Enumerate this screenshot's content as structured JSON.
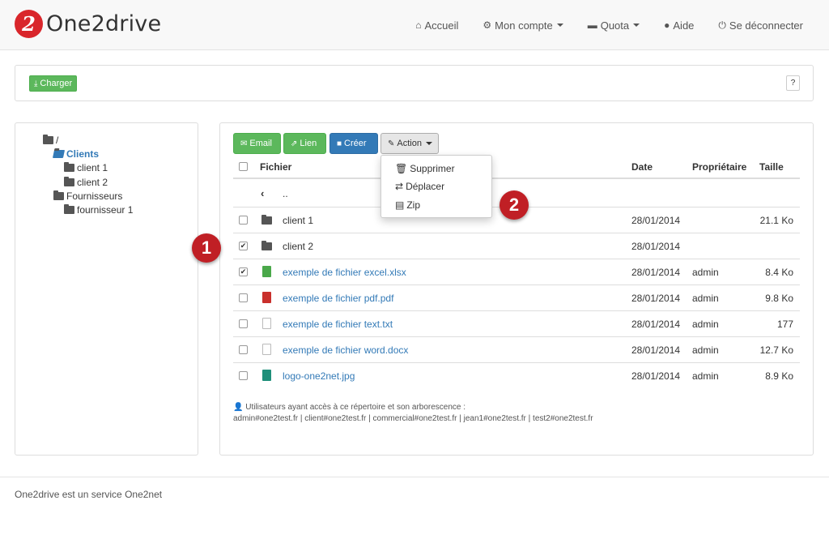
{
  "brand": {
    "logo_letter": "2",
    "name": "One2drive"
  },
  "nav": {
    "home": "Accueil",
    "account": "Mon compte",
    "quota": "Quota",
    "help": "Aide",
    "logout": "Se déconnecter"
  },
  "upload": {
    "charger_label": "Charger",
    "help_label": "?"
  },
  "tree": {
    "root": "/",
    "clients": "Clients",
    "client1": "client 1",
    "client2": "client 2",
    "fournisseurs": "Fournisseurs",
    "fournisseur1": "fournisseur 1"
  },
  "toolbar": {
    "email": "Email",
    "lien": "Lien",
    "creer": "Créer",
    "action": "Action"
  },
  "dropdown": {
    "supprimer": "Supprimer",
    "deplacer": "Déplacer",
    "zip": "Zip"
  },
  "table": {
    "headers": {
      "fichier": "Fichier",
      "date": "Date",
      "proprietaire": "Propriétaire",
      "taille": "Taille"
    },
    "parent": "..",
    "rows": [
      {
        "name": "client 1",
        "date": "28/01/2014",
        "owner": "",
        "size": "21.1 Ko",
        "checked": false,
        "type": "folder"
      },
      {
        "name": "client 2",
        "date": "28/01/2014",
        "owner": "",
        "size": "",
        "checked": true,
        "type": "folder"
      },
      {
        "name": "exemple de fichier excel.xlsx",
        "date": "28/01/2014",
        "owner": "admin",
        "size": "8.4 Ko",
        "checked": true,
        "type": "xlsx"
      },
      {
        "name": "exemple de fichier pdf.pdf",
        "date": "28/01/2014",
        "owner": "admin",
        "size": "9.8 Ko",
        "checked": false,
        "type": "pdf"
      },
      {
        "name": "exemple de fichier text.txt",
        "date": "28/01/2014",
        "owner": "admin",
        "size": "177",
        "checked": false,
        "type": "txt"
      },
      {
        "name": "exemple de fichier word.docx",
        "date": "28/01/2014",
        "owner": "admin",
        "size": "12.7 Ko",
        "checked": false,
        "type": "docx"
      },
      {
        "name": "logo-one2net.jpg",
        "date": "28/01/2014",
        "owner": "admin",
        "size": "8.9 Ko",
        "checked": false,
        "type": "jpg"
      }
    ]
  },
  "access": {
    "line1": "Utilisateurs ayant accès à ce répertoire et son arborescence :",
    "line2": "admin#one2test.fr | client#one2test.fr | commercial#one2test.fr | jean1#one2test.fr | test2#one2test.fr"
  },
  "markers": {
    "m1": "1",
    "m2": "2"
  },
  "footer": {
    "text": "One2drive est un service One2net"
  },
  "colors": {
    "brand_red": "#d9262b",
    "success": "#5cb85c",
    "primary": "#337ab7"
  }
}
